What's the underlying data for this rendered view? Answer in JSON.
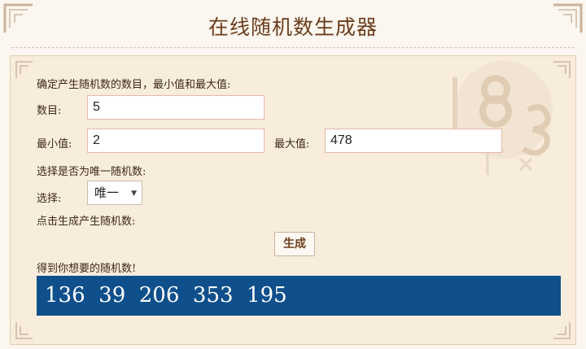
{
  "header": {
    "title": "在线随机数生成器"
  },
  "form": {
    "intro": "确定产生随机数的数目，最小值和最大值:",
    "count_label": "数目:",
    "count_value": "5",
    "min_label": "最小值:",
    "min_value": "2",
    "max_label": "最大值:",
    "max_value": "478",
    "unique_prompt": "选择是否为唯一随机数:",
    "select_label": "选择:",
    "select_value": "唯一",
    "generate_prompt": "点击生成产生随机数:",
    "generate_button": "生成",
    "result_prompt": "得到你想要的随机数!",
    "result_text": "136  39  206  353  195"
  },
  "colors": {
    "title": "#6b3d1c",
    "panel_bg": "#f8ecdc",
    "result_bg": "#0f4f8c",
    "input_border": "#e6b8a8"
  },
  "icons": {
    "select_caret": "triangle-down-icon"
  }
}
